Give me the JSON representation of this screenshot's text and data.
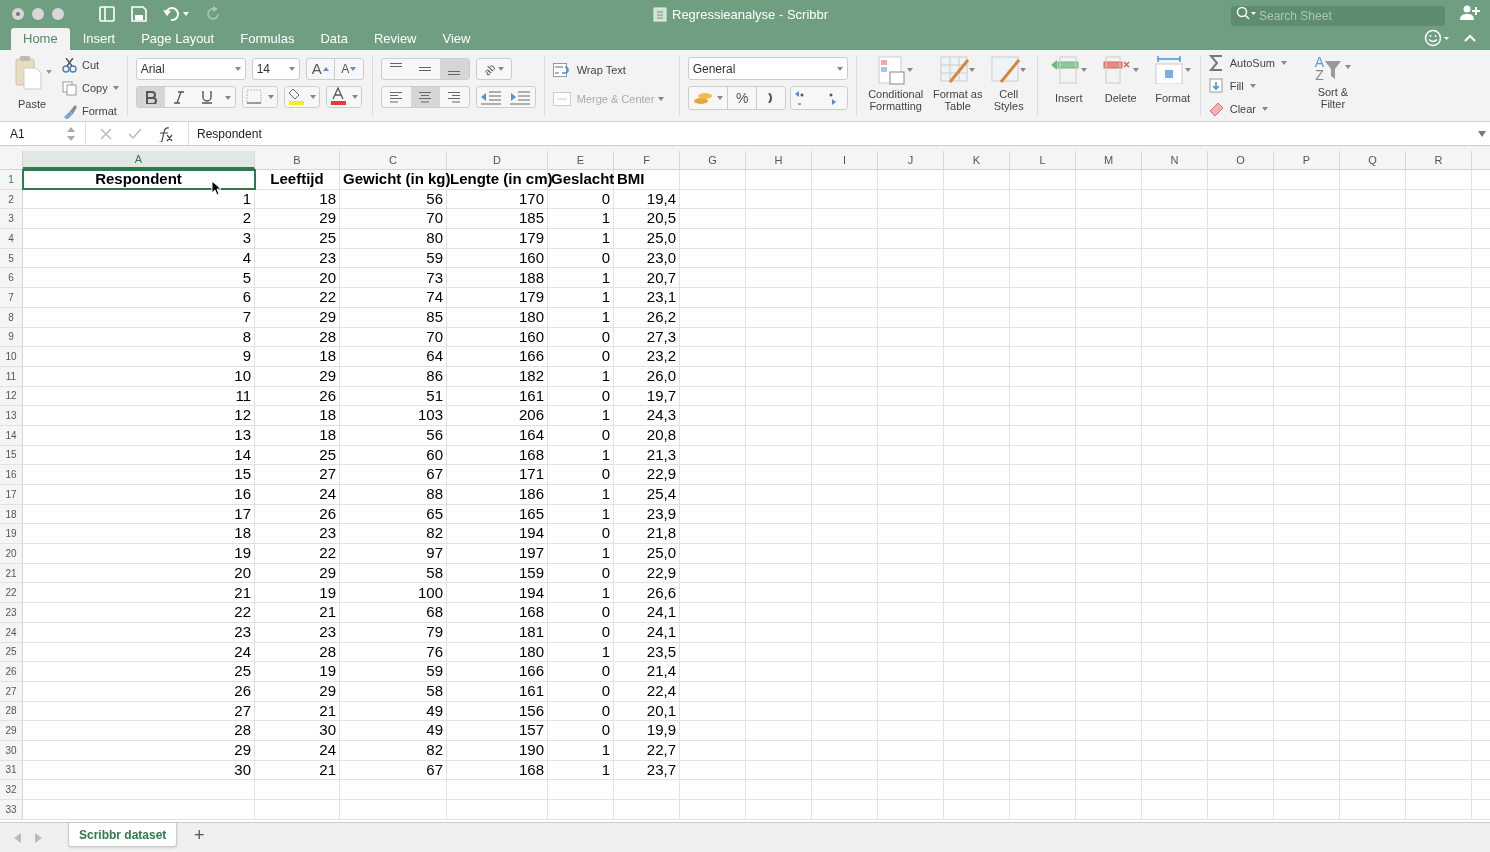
{
  "window": {
    "title": "Regressieanalyse - Scribbr",
    "search": {
      "placeholder": "Search Sheet"
    }
  },
  "tabs": [
    {
      "label": "Home",
      "selected": true
    },
    {
      "label": "Insert",
      "selected": false
    },
    {
      "label": "Page Layout",
      "selected": false
    },
    {
      "label": "Formulas",
      "selected": false
    },
    {
      "label": "Data",
      "selected": false
    },
    {
      "label": "Review",
      "selected": false
    },
    {
      "label": "View",
      "selected": false
    }
  ],
  "clipboard": {
    "paste": "Paste",
    "cut": "Cut",
    "copy": "Copy",
    "format": "Format"
  },
  "font": {
    "name": "Arial",
    "size": "14",
    "grow": "A",
    "shrink": "A",
    "bold": true,
    "italic": false,
    "underline": false
  },
  "alignment": {
    "orientation": "ab",
    "vertical": [
      {
        "selected": false
      },
      {
        "selected": false
      },
      {
        "selected": true
      }
    ],
    "horizontal": [
      {
        "selected": false
      },
      {
        "selected": true
      },
      {
        "selected": false
      }
    ],
    "wrap_text": "Wrap Text",
    "merge_center": {
      "label": "Merge & Center",
      "disabled": true
    }
  },
  "number": {
    "format": "General",
    "percent": "%"
  },
  "styles": [
    "Conditional Formatting",
    "Format as Table",
    "Cell Styles"
  ],
  "cells": [
    "Insert",
    "Delete",
    "Format"
  ],
  "editing": {
    "autosum": "AutoSum",
    "fill": "Fill",
    "clear": "Clear",
    "sort_filter": "Sort & Filter",
    "sort_letters": [
      "A",
      "Z"
    ]
  },
  "formula_bar": {
    "name_box": "A1",
    "formula": "Respondent"
  },
  "sheet": {
    "columns": [
      {
        "label": "A",
        "selected": true
      },
      {
        "label": "B",
        "selected": false
      },
      {
        "label": "C",
        "selected": false
      },
      {
        "label": "D",
        "selected": false
      },
      {
        "label": "E",
        "selected": false
      },
      {
        "label": "F",
        "selected": false
      },
      {
        "label": "G",
        "selected": false
      },
      {
        "label": "H",
        "selected": false
      },
      {
        "label": "I",
        "selected": false
      },
      {
        "label": "J",
        "selected": false
      },
      {
        "label": "K",
        "selected": false
      },
      {
        "label": "L",
        "selected": false
      },
      {
        "label": "M",
        "selected": false
      },
      {
        "label": "N",
        "selected": false
      },
      {
        "label": "O",
        "selected": false
      },
      {
        "label": "P",
        "selected": false
      },
      {
        "label": "Q",
        "selected": false
      },
      {
        "label": "R",
        "selected": false
      }
    ],
    "rows": [
      {
        "number": "1",
        "selected": true,
        "cells": [
          "Respondent",
          "Leeftijd",
          "Gewicht (in kg)",
          "Lengte (in cm)",
          "Geslacht",
          "BMI"
        ]
      },
      {
        "number": "2",
        "selected": false,
        "cells": [
          "1",
          "18",
          "56",
          "170",
          "0",
          "19,4"
        ]
      },
      {
        "number": "3",
        "selected": false,
        "cells": [
          "2",
          "29",
          "70",
          "185",
          "1",
          "20,5"
        ]
      },
      {
        "number": "4",
        "selected": false,
        "cells": [
          "3",
          "25",
          "80",
          "179",
          "1",
          "25,0"
        ]
      },
      {
        "number": "5",
        "selected": false,
        "cells": [
          "4",
          "23",
          "59",
          "160",
          "0",
          "23,0"
        ]
      },
      {
        "number": "6",
        "selected": false,
        "cells": [
          "5",
          "20",
          "73",
          "188",
          "1",
          "20,7"
        ]
      },
      {
        "number": "7",
        "selected": false,
        "cells": [
          "6",
          "22",
          "74",
          "179",
          "1",
          "23,1"
        ]
      },
      {
        "number": "8",
        "selected": false,
        "cells": [
          "7",
          "29",
          "85",
          "180",
          "1",
          "26,2"
        ]
      },
      {
        "number": "9",
        "selected": false,
        "cells": [
          "8",
          "28",
          "70",
          "160",
          "0",
          "27,3"
        ]
      },
      {
        "number": "10",
        "selected": false,
        "cells": [
          "9",
          "18",
          "64",
          "166",
          "0",
          "23,2"
        ]
      },
      {
        "number": "11",
        "selected": false,
        "cells": [
          "10",
          "29",
          "86",
          "182",
          "1",
          "26,0"
        ]
      },
      {
        "number": "12",
        "selected": false,
        "cells": [
          "11",
          "26",
          "51",
          "161",
          "0",
          "19,7"
        ]
      },
      {
        "number": "13",
        "selected": false,
        "cells": [
          "12",
          "18",
          "103",
          "206",
          "1",
          "24,3"
        ]
      },
      {
        "number": "14",
        "selected": false,
        "cells": [
          "13",
          "18",
          "56",
          "164",
          "0",
          "20,8"
        ]
      },
      {
        "number": "15",
        "selected": false,
        "cells": [
          "14",
          "25",
          "60",
          "168",
          "1",
          "21,3"
        ]
      },
      {
        "number": "16",
        "selected": false,
        "cells": [
          "15",
          "27",
          "67",
          "171",
          "0",
          "22,9"
        ]
      },
      {
        "number": "17",
        "selected": false,
        "cells": [
          "16",
          "24",
          "88",
          "186",
          "1",
          "25,4"
        ]
      },
      {
        "number": "18",
        "selected": false,
        "cells": [
          "17",
          "26",
          "65",
          "165",
          "1",
          "23,9"
        ]
      },
      {
        "number": "19",
        "selected": false,
        "cells": [
          "18",
          "23",
          "82",
          "194",
          "0",
          "21,8"
        ]
      },
      {
        "number": "20",
        "selected": false,
        "cells": [
          "19",
          "22",
          "97",
          "197",
          "1",
          "25,0"
        ]
      },
      {
        "number": "21",
        "selected": false,
        "cells": [
          "20",
          "29",
          "58",
          "159",
          "0",
          "22,9"
        ]
      },
      {
        "number": "22",
        "selected": false,
        "cells": [
          "21",
          "19",
          "100",
          "194",
          "1",
          "26,6"
        ]
      },
      {
        "number": "23",
        "selected": false,
        "cells": [
          "22",
          "21",
          "68",
          "168",
          "0",
          "24,1"
        ]
      },
      {
        "number": "24",
        "selected": false,
        "cells": [
          "23",
          "23",
          "79",
          "181",
          "0",
          "24,1"
        ]
      },
      {
        "number": "25",
        "selected": false,
        "cells": [
          "24",
          "28",
          "76",
          "180",
          "1",
          "23,5"
        ]
      },
      {
        "number": "26",
        "selected": false,
        "cells": [
          "25",
          "19",
          "59",
          "166",
          "0",
          "21,4"
        ]
      },
      {
        "number": "27",
        "selected": false,
        "cells": [
          "26",
          "29",
          "58",
          "161",
          "0",
          "22,4"
        ]
      },
      {
        "number": "28",
        "selected": false,
        "cells": [
          "27",
          "21",
          "49",
          "156",
          "0",
          "20,1"
        ]
      },
      {
        "number": "29",
        "selected": false,
        "cells": [
          "28",
          "30",
          "49",
          "157",
          "0",
          "19,9"
        ]
      },
      {
        "number": "30",
        "selected": false,
        "cells": [
          "29",
          "24",
          "82",
          "190",
          "1",
          "22,7"
        ]
      },
      {
        "number": "31",
        "selected": false,
        "cells": [
          "30",
          "21",
          "67",
          "168",
          "1",
          "23,7"
        ]
      },
      {
        "number": "32",
        "selected": false,
        "cells": []
      },
      {
        "number": "33",
        "selected": false,
        "cells": []
      }
    ]
  },
  "sheet_tabs": [
    {
      "label": "Scribbr dataset",
      "selected": true
    }
  ],
  "new_sheet": "+"
}
